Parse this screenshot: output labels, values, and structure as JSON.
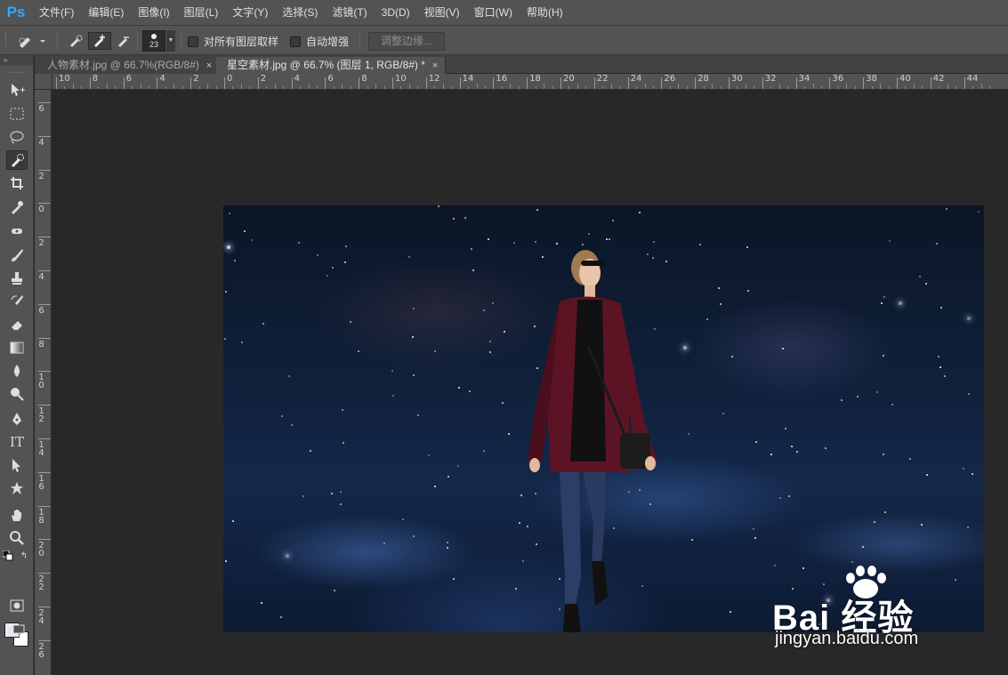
{
  "app": {
    "logo": "Ps"
  },
  "menu": [
    "文件(F)",
    "编辑(E)",
    "图像(I)",
    "图层(L)",
    "文字(Y)",
    "选择(S)",
    "滤镜(T)",
    "3D(D)",
    "视图(V)",
    "窗口(W)",
    "帮助(H)"
  ],
  "options": {
    "brush_size": "23",
    "sample_all_layers_label": "对所有图层取样",
    "sample_all_layers_checked": false,
    "auto_enhance_label": "自动增强",
    "auto_enhance_checked": false,
    "refine_edge_label": "调整边缘..."
  },
  "tabs": [
    {
      "label": "人物素材.jpg @ 66.7%(RGB/8#)",
      "active": false
    },
    {
      "label": "星空素材.jpg @ 66.7% (图层 1, RGB/8#) *",
      "active": true
    }
  ],
  "ruler_top_labels": [
    "10",
    "8",
    "6",
    "4",
    "2",
    "0",
    "2",
    "4",
    "6",
    "8",
    "10",
    "12",
    "14",
    "16",
    "18",
    "20",
    "22",
    "24",
    "26",
    "28",
    "30",
    "32",
    "34",
    "36",
    "38",
    "40",
    "42",
    "44"
  ],
  "ruler_left_labels": [
    "6",
    "4",
    "2",
    "0",
    "2",
    "4",
    "6",
    "8",
    "1\n0",
    "1\n2",
    "1\n4",
    "1\n6",
    "1\n8",
    "2\n0",
    "2\n2",
    "2\n4",
    "2\n6"
  ],
  "colors": {
    "foreground": "#e8edf5",
    "background": "#ffffff",
    "accent": "#31a8ff"
  },
  "tools": [
    "move-tool",
    "marquee-tool",
    "lasso-tool",
    "quick-selection-tool",
    "crop-tool",
    "eyedropper-tool",
    "spot-healing-tool",
    "brush-tool",
    "clone-stamp-tool",
    "history-brush-tool",
    "eraser-tool",
    "gradient-tool",
    "blur-tool",
    "dodge-tool",
    "pen-tool",
    "type-tool",
    "path-selection-tool",
    "shape-tool",
    "hand-tool",
    "zoom-tool"
  ],
  "watermark": {
    "main": "Bai 经验",
    "sub": "jingyan.baidu.com"
  }
}
